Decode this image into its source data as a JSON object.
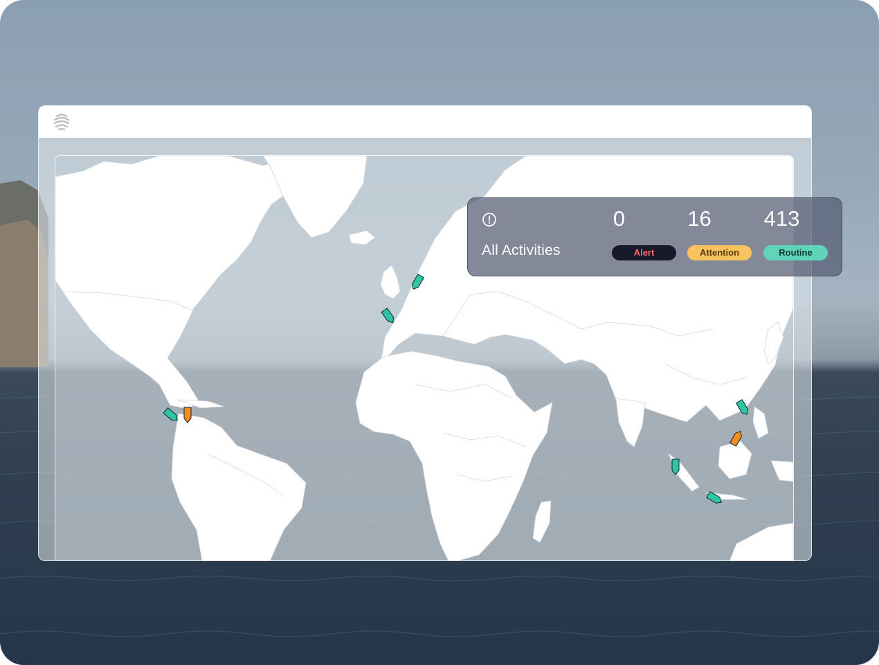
{
  "stats": {
    "title": "All Activities",
    "icon": "alert-circle-icon",
    "categories": [
      {
        "count": "0",
        "label": "Alert",
        "color": "#161a2b"
      },
      {
        "count": "16",
        "label": "Attention",
        "color": "#f7c35f"
      },
      {
        "count": "413",
        "label": "Routine",
        "color": "#5fd4bb"
      }
    ]
  },
  "colors": {
    "routine": "#2fc4a4",
    "attention": "#f28c22",
    "land": "#ffffff"
  },
  "app": {
    "logo_icon": "app-logo-icon"
  }
}
